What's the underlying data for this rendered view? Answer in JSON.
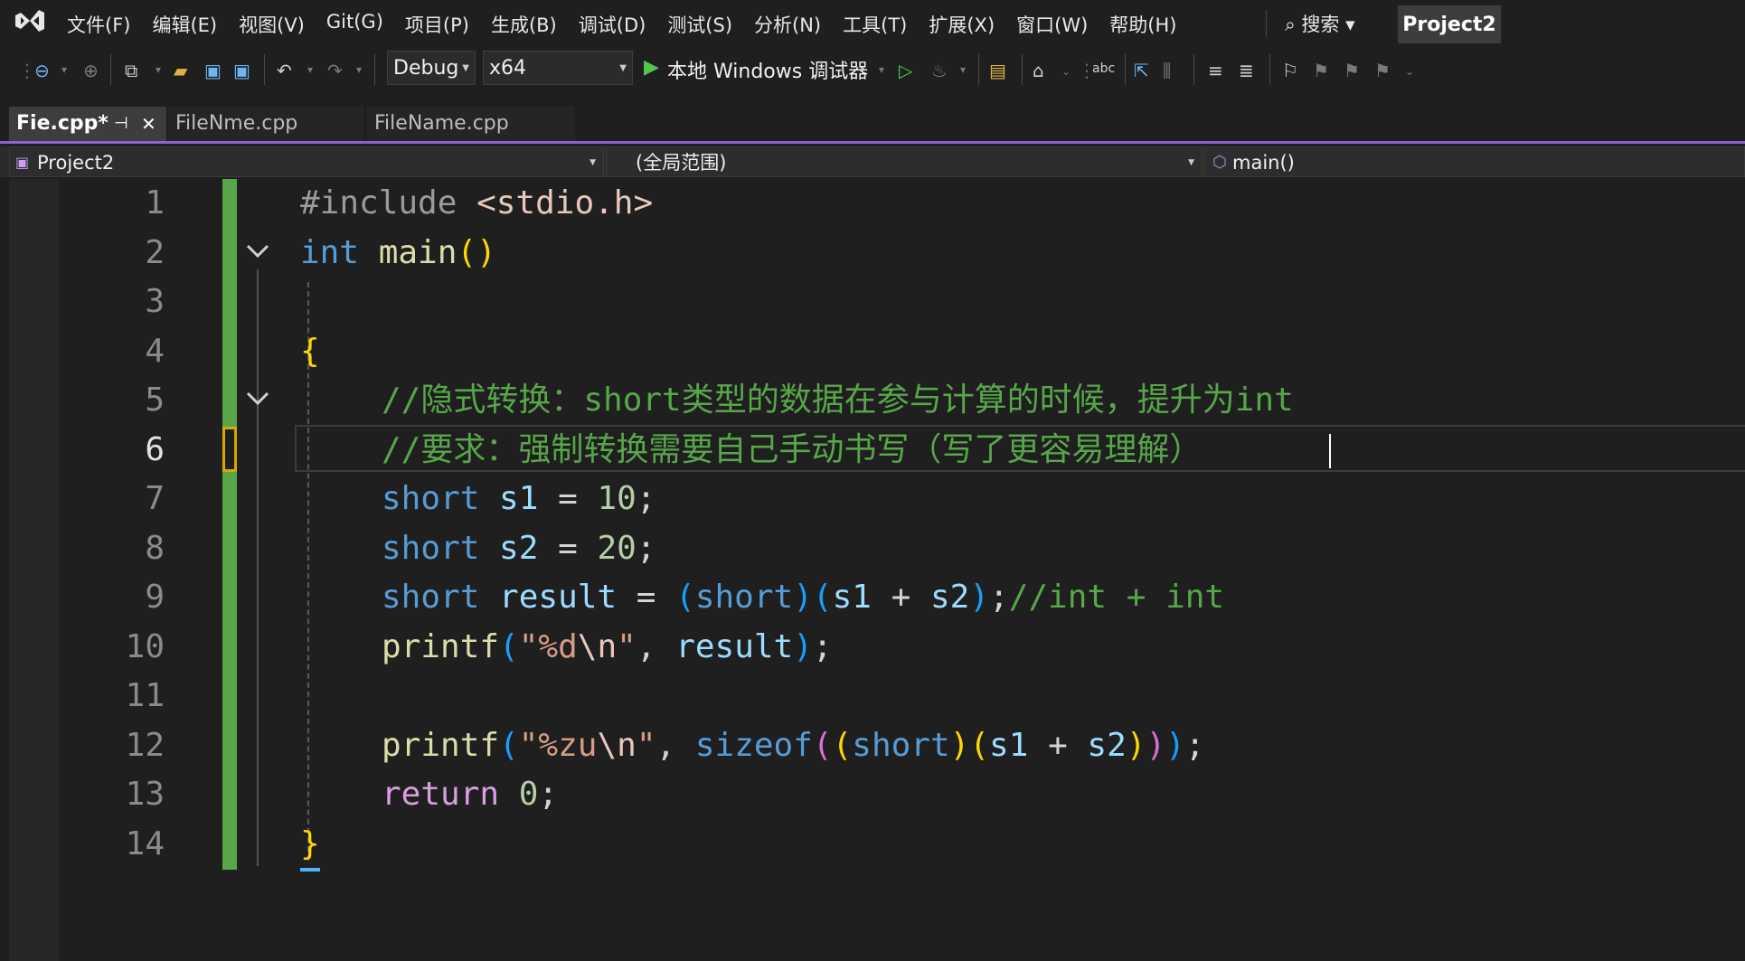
{
  "menubar": {
    "items": [
      "文件(F)",
      "编辑(E)",
      "视图(V)",
      "Git(G)",
      "项目(P)",
      "生成(B)",
      "调试(D)",
      "测试(S)",
      "分析(N)",
      "工具(T)",
      "扩展(X)",
      "窗口(W)",
      "帮助(H)"
    ],
    "search_label": "⌕ 搜索 ▾",
    "project_name": "Project2"
  },
  "toolbar": {
    "config": "Debug",
    "platform": "x64",
    "run_label": "本地 Windows 调试器",
    "run_dropdown": "▾"
  },
  "tabs": [
    {
      "label": "Fie.cpp*",
      "pin": "⊣",
      "close": "✕"
    },
    {
      "label": "FileNme.cpp"
    },
    {
      "label": "FileName.cpp"
    }
  ],
  "navbar": {
    "project": "Project2",
    "scope": "(全局范围)",
    "member": "main()"
  },
  "editor": {
    "line_numbers": [
      "1",
      "2",
      "3",
      "4",
      "5",
      "6",
      "7",
      "8",
      "9",
      "10",
      "11",
      "12",
      "13",
      "14"
    ],
    "current_line": 6,
    "lines": {
      "l1": {
        "directive": "#include ",
        "header": "<stdio.h>"
      },
      "l2": {
        "type": "int",
        "name": " main",
        "parens": "()"
      },
      "l4": {
        "brace": "{"
      },
      "l5": {
        "comment": "//隐式转换：short类型的数据在参与计算的时候，提升为int"
      },
      "l6": {
        "comment": "//要求：强制转换需要自己手动书写（写了更容易理解）"
      },
      "l7": {
        "type": "short",
        "var": " s1",
        "op": " = ",
        "num": "10",
        "end": ";"
      },
      "l8": {
        "type": "short",
        "var": " s2",
        "op": " = ",
        "num": "20",
        "end": ";"
      },
      "l9": {
        "type": "short",
        "var": " result",
        "op": " = ",
        "p1": "(",
        "cast": "short",
        "p2": ")",
        "p3": "(",
        "a": "s1",
        "plus": " + ",
        "b": "s2",
        "p4": ")",
        "end": ";",
        "comment": "//int + int"
      },
      "l10": {
        "fn": "printf",
        "p1": "(",
        "q1": "\"",
        "fmt": "%d",
        "esc": "\\n",
        "q2": "\"",
        "comma": ", ",
        "var": "result",
        "p2": ")",
        "end": ";"
      },
      "l12": {
        "fn": "printf",
        "p1": "(",
        "q1": "\"",
        "fmt": "%zu",
        "esc": "\\n",
        "q2": "\"",
        "comma": ", ",
        "op": "sizeof",
        "p2": "(",
        "p3": "(",
        "cast": "short",
        "p4": ")",
        "p5": "(",
        "a": "s1",
        "plus": " + ",
        "b": "s2",
        "p6": ")",
        "p7": ")",
        "p8": ")",
        "end": ";"
      },
      "l13": {
        "kw": "return",
        "num": " 0",
        "end": ";"
      },
      "l14": {
        "brace": "}"
      }
    }
  }
}
